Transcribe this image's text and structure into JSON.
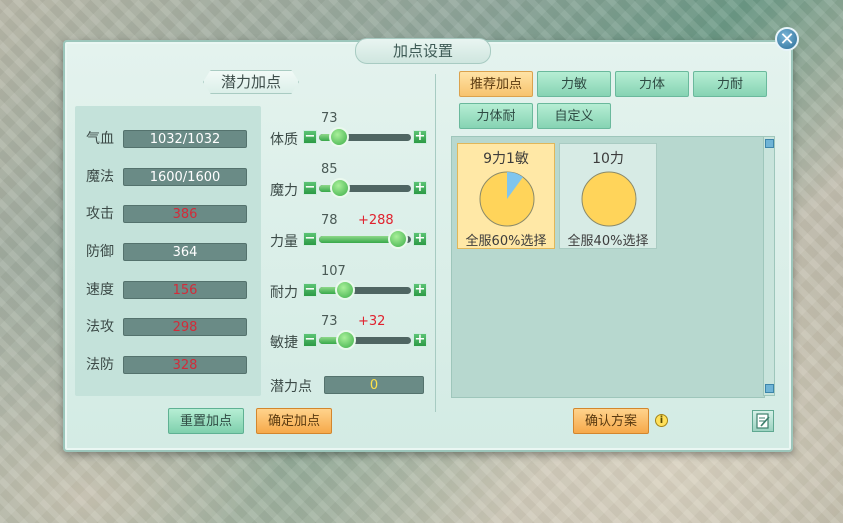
{
  "window": {
    "title": "加点设置"
  },
  "left": {
    "subtitle": "潜力加点",
    "stats": [
      {
        "label": "气血",
        "value": "1032/1032",
        "highlight": false
      },
      {
        "label": "魔法",
        "value": "1600/1600",
        "highlight": false
      },
      {
        "label": "攻击",
        "value": "386",
        "highlight": true
      },
      {
        "label": "防御",
        "value": "364",
        "highlight": false
      },
      {
        "label": "速度",
        "value": "156",
        "highlight": true
      },
      {
        "label": "法攻",
        "value": "298",
        "highlight": true
      },
      {
        "label": "法防",
        "value": "328",
        "highlight": true
      }
    ],
    "attributes": [
      {
        "label": "体质",
        "value": "73",
        "bonus": "",
        "fraction": 0.22
      },
      {
        "label": "魔力",
        "value": "85",
        "bonus": "",
        "fraction": 0.23
      },
      {
        "label": "力量",
        "value": "78",
        "bonus": "+288",
        "fraction": 0.86
      },
      {
        "label": "耐力",
        "value": "107",
        "bonus": "",
        "fraction": 0.28
      },
      {
        "label": "敏捷",
        "value": "73",
        "bonus": "+32",
        "fraction": 0.29
      }
    ],
    "potential_label": "潜力点",
    "potential_value": "0",
    "reset_button": "重置加点",
    "confirm_button": "确定加点"
  },
  "right": {
    "tabs": [
      "推荐加点",
      "力敏",
      "力体",
      "力耐",
      "力体耐",
      "自定义"
    ],
    "active_tab": 0,
    "plans": [
      {
        "title": "9力1敏",
        "subtitle": "全服60%选择",
        "selected": true,
        "pie_fraction": 0.1
      },
      {
        "title": "10力",
        "subtitle": "全服40%选择",
        "selected": false,
        "pie_fraction": 0
      }
    ],
    "confirm_plan_button": "确认方案",
    "info_glyph": "i"
  },
  "icons": {
    "close": "close-icon",
    "info": "info-icon",
    "edit": "edit-note-icon"
  },
  "colors": {
    "pie_main": "#ffd45a",
    "pie_slice": "#7fc5ee",
    "card_selected": "#ffe8a6",
    "card_normal": "#d7ebe5"
  }
}
